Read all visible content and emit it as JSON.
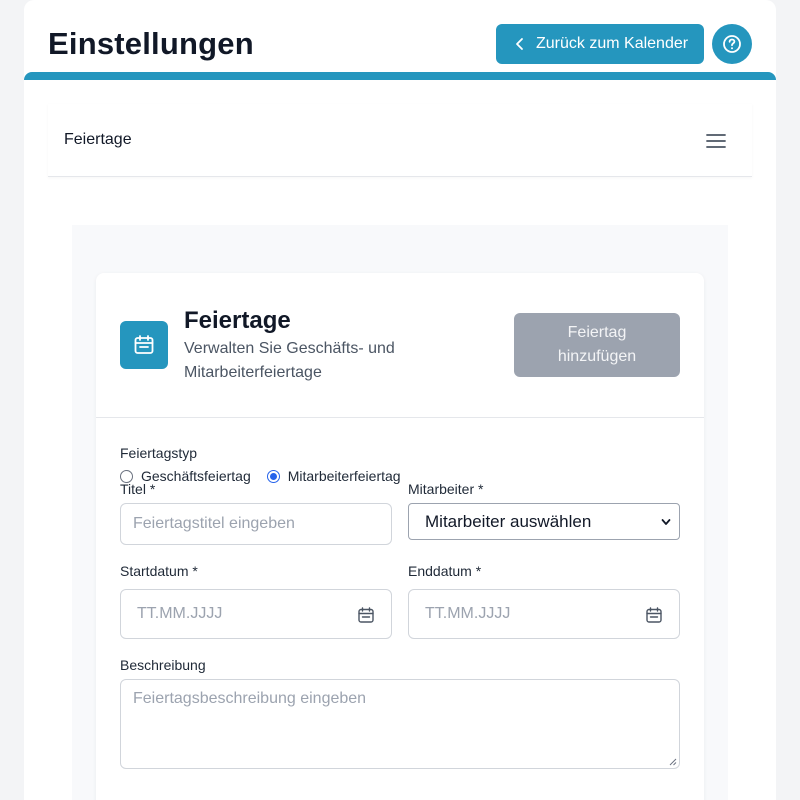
{
  "header": {
    "title": "Einstellungen",
    "back_button_label": "Zurück zum Kalender"
  },
  "section": {
    "title": "Feiertage"
  },
  "card": {
    "title": "Feiertage",
    "subtitle": "Verwalten Sie Geschäfts- und Mitarbeiterfeiertage",
    "add_button_label": "Feiertag hinzufügen"
  },
  "form": {
    "type_label": "Feiertagstyp",
    "type_options": [
      {
        "label": "Geschäftsfeiertag",
        "selected": false
      },
      {
        "label": "Mitarbeiterfeiertag",
        "selected": true
      }
    ],
    "title_label": "Titel *",
    "title_placeholder": "Feiertagstitel eingeben",
    "employee_label": "Mitarbeiter *",
    "employee_selected": "Mitarbeiter auswählen",
    "start_label": "Startdatum *",
    "start_placeholder": "TT.MM.JJJJ",
    "end_label": "Enddatum *",
    "end_placeholder": "TT.MM.JJJJ",
    "description_label": "Beschreibung",
    "description_placeholder": "Feiertagsbeschreibung eingeben"
  },
  "colors": {
    "accent": "#2596be",
    "disabled_button": "#9ca3af",
    "radio_checked": "#2563eb"
  },
  "icons": {
    "back": "chevron-left-icon",
    "help": "help-circle-icon",
    "menu": "hamburger-menu-icon",
    "calendar": "calendar-icon"
  }
}
